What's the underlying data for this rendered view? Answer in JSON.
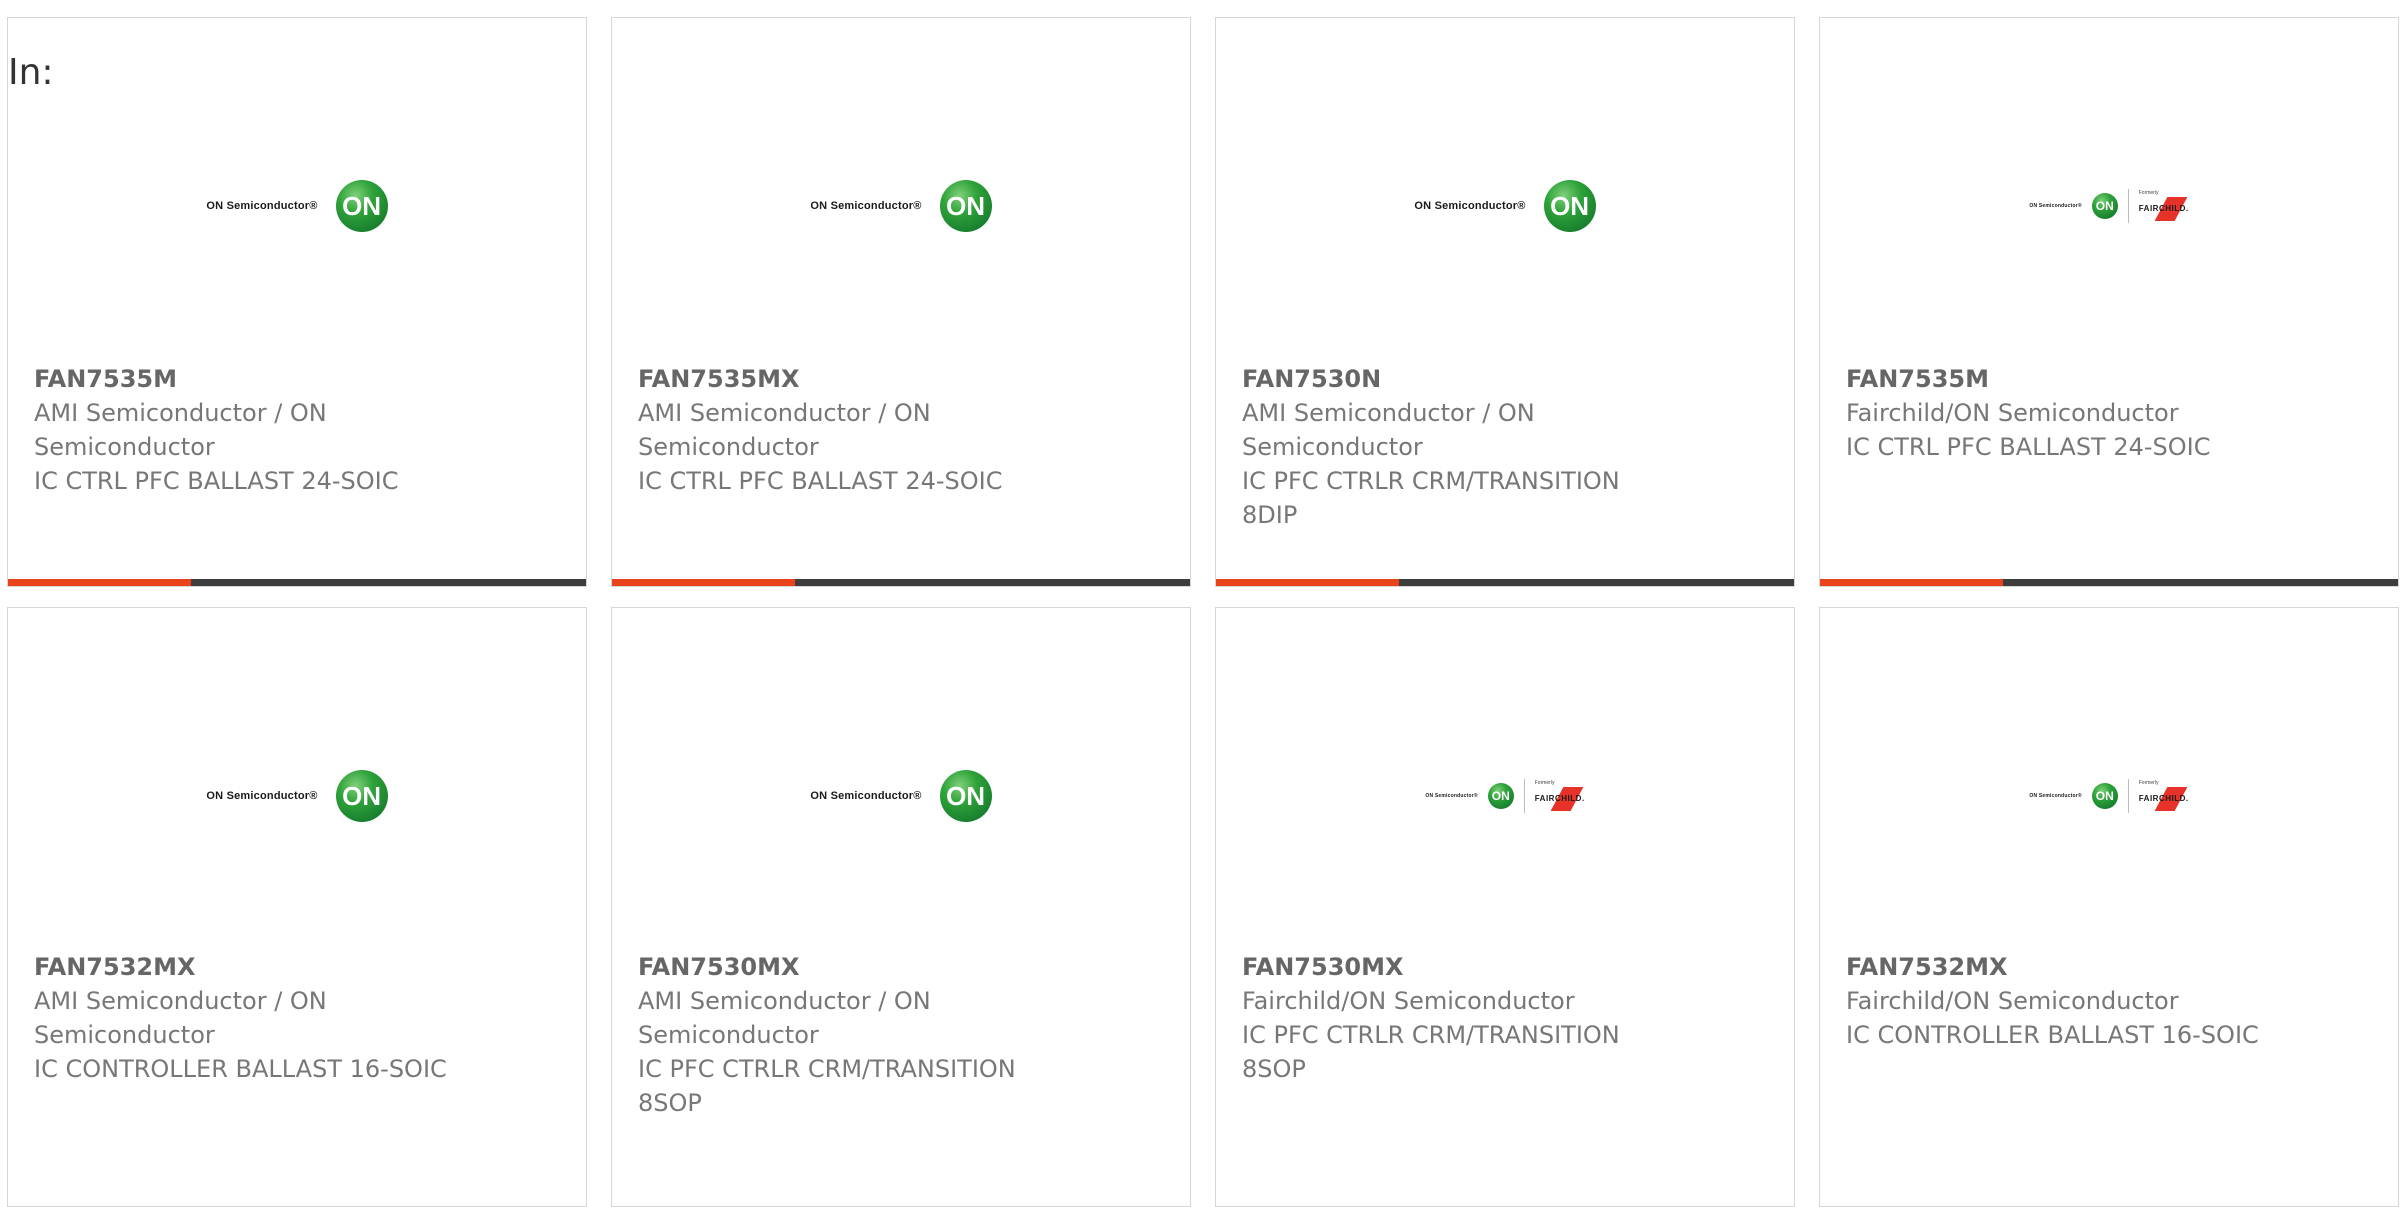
{
  "heading": "In:",
  "logos": {
    "on_semi": {
      "text": "ON Semiconductor®",
      "badge": "ON",
      "color": "#2fa33a"
    },
    "fairchild": {
      "on_text": "ON Semiconductor®",
      "badge": "ON",
      "formerly": "Formerly",
      "brand": "FAIRCHILD.",
      "slash_color": "#e63228"
    }
  },
  "accent_color": "#e8431b",
  "cards": [
    {
      "part": "FAN7535M",
      "manufacturer": "AMI Semiconductor / ON Semiconductor",
      "description": "IC CTRL PFC BALLAST 24-SOIC"
    },
    {
      "part": "FAN7535MX",
      "manufacturer": "AMI Semiconductor / ON Semiconductor",
      "description": "IC CTRL PFC BALLAST 24-SOIC"
    },
    {
      "part": "FAN7530N",
      "manufacturer": "AMI Semiconductor / ON Semiconductor",
      "description": "IC PFC CTRLR CRM/TRANSITION 8DIP"
    },
    {
      "part": "FAN7535M",
      "manufacturer": "Fairchild/ON Semiconductor",
      "description": "IC CTRL PFC BALLAST 24-SOIC"
    },
    {
      "part": "FAN7532MX",
      "manufacturer": "AMI Semiconductor / ON Semiconductor",
      "description": "IC CONTROLLER BALLAST 16-SOIC"
    },
    {
      "part": "FAN7530MX",
      "manufacturer": "AMI Semiconductor / ON Semiconductor",
      "description": "IC PFC CTRLR CRM/TRANSITION 8SOP"
    },
    {
      "part": "FAN7530MX",
      "manufacturer": "Fairchild/ON Semiconductor",
      "description": "IC PFC CTRLR CRM/TRANSITION 8SOP"
    },
    {
      "part": "FAN7532MX",
      "manufacturer": "Fairchild/ON Semiconductor",
      "description": "IC CONTROLLER BALLAST 16-SOIC"
    }
  ]
}
